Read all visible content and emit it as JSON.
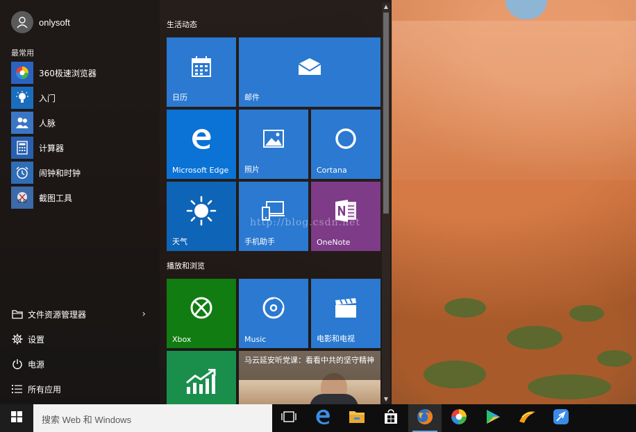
{
  "user": {
    "name": "onlysoft",
    "icon": "user-avatar-icon"
  },
  "most_used": {
    "label": "最常用",
    "items": [
      {
        "label": "360极速浏览器",
        "icon": "browser-icon",
        "color": "#2b63c0"
      },
      {
        "label": "入门",
        "icon": "lightbulb-icon",
        "color": "#1a6dbd"
      },
      {
        "label": "人脉",
        "icon": "people-icon",
        "color": "#3a76c4"
      },
      {
        "label": "计算器",
        "icon": "calculator-icon",
        "color": "#2860b0"
      },
      {
        "label": "闹钟和时钟",
        "icon": "alarm-clock-icon",
        "color": "#2f6db6"
      },
      {
        "label": "截图工具",
        "icon": "snipping-tool-icon",
        "color": "#3d6aa8"
      }
    ]
  },
  "bottom": [
    {
      "label": "文件资源管理器",
      "icon": "file-explorer-icon",
      "has_chevron": true,
      "chevron": "›"
    },
    {
      "label": "设置",
      "icon": "settings-gear-icon"
    },
    {
      "label": "电源",
      "icon": "power-icon"
    },
    {
      "label": "所有应用",
      "icon": "all-apps-list-icon"
    }
  ],
  "groups": [
    {
      "label": "生活动态"
    },
    {
      "label": "播放和浏览"
    }
  ],
  "tiles": [
    {
      "label": "日历",
      "icon": "calendar-icon",
      "color": "#2b79d1"
    },
    {
      "label": "邮件",
      "icon": "mail-icon",
      "color": "#2b79d1"
    },
    {
      "label": "Microsoft Edge",
      "icon": "edge-icon",
      "color": "#0b72d6"
    },
    {
      "label": "照片",
      "icon": "photos-icon",
      "color": "#2b79d1"
    },
    {
      "label": "Cortana",
      "icon": "cortana-icon",
      "color": "#2b79d1"
    },
    {
      "label": "天气",
      "icon": "weather-sun-icon",
      "color": "#0e64b6"
    },
    {
      "label": "手机助手",
      "icon": "phone-companion-icon",
      "color": "#2b79d1"
    },
    {
      "label": "OneNote",
      "icon": "onenote-icon",
      "color": "#7d3b88"
    },
    {
      "label": "Xbox",
      "icon": "xbox-icon",
      "color": "#117c11"
    },
    {
      "label": "Music",
      "icon": "music-icon",
      "color": "#2b79d1"
    },
    {
      "label": "电影和电视",
      "icon": "movies-tv-icon",
      "color": "#2b79d1"
    },
    {
      "label": "",
      "icon": "money-chart-icon",
      "color": "#1a8f4c"
    }
  ],
  "news": {
    "headline": "马云延安听党课：看看中共的坚守精神"
  },
  "watermark": "http://blog.csdn.net",
  "taskbar": {
    "search_placeholder": "搜索 Web 和 Windows",
    "icons": [
      {
        "icon": "task-view-icon"
      },
      {
        "icon": "edge-icon"
      },
      {
        "icon": "file-explorer-icon"
      },
      {
        "icon": "store-icon"
      },
      {
        "icon": "firefox-icon",
        "active": true
      },
      {
        "icon": "360-browser-icon"
      },
      {
        "icon": "video-player-icon"
      },
      {
        "icon": "game-app-icon"
      },
      {
        "icon": "feather-app-icon"
      }
    ]
  }
}
